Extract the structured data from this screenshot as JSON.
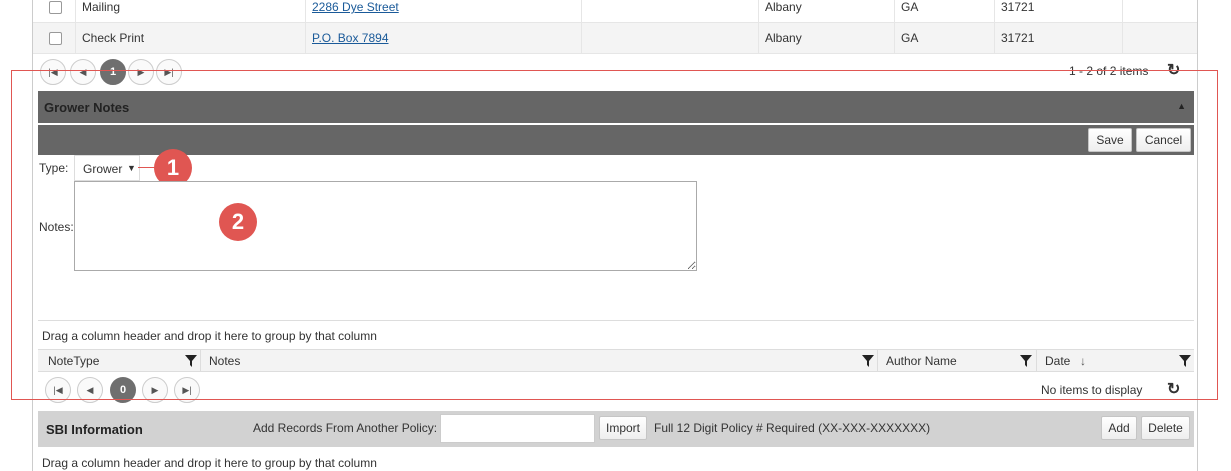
{
  "addresses": {
    "rows": [
      {
        "type": "Mailing",
        "street": "2286 Dye Street",
        "city": "Albany",
        "state": "GA",
        "zip": "31721"
      },
      {
        "type": "Check Print",
        "street": "P.O. Box 7894",
        "city": "Albany",
        "state": "GA",
        "zip": "31721"
      }
    ],
    "pager": {
      "page": "1",
      "info": "1 - 2 of 2 items"
    }
  },
  "grower_notes": {
    "title": "Grower Notes",
    "collapse_icon": "caret-up-icon",
    "save_label": "Save",
    "cancel_label": "Cancel",
    "type_label": "Type:",
    "type_value": "Grower",
    "notes_label": "Notes:",
    "notes_value": "",
    "group_hint": "Drag a column header and drop it here to group by that column",
    "columns": [
      "NoteType",
      "Notes",
      "Author Name",
      "Date"
    ],
    "sort_indicator": "↓",
    "pager": {
      "page": "0",
      "info": "No items to display"
    }
  },
  "callouts": [
    "1",
    "2"
  ],
  "sbi": {
    "title": "SBI Information",
    "add_records_label": "Add Records From Another Policy:",
    "policy_input_value": "",
    "import_label": "Import",
    "hint": "Full 12 Digit Policy # Required (XX-XXX-XXXXXXX)",
    "add_label": "Add",
    "delete_label": "Delete",
    "group_hint": "Drag a column header and drop it here to group by that column"
  },
  "colors": {
    "highlight_border": "#e05652",
    "section_header": "#666666",
    "callout": "#e05652"
  }
}
